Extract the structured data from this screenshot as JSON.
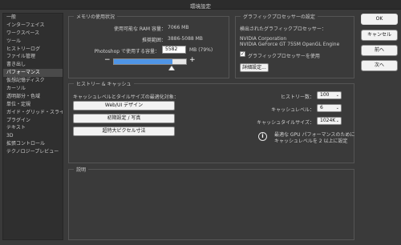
{
  "window": {
    "title": "環境設定"
  },
  "sidebar": {
    "items": [
      "一般",
      "インターフェイス",
      "ワークスペース",
      "ツール",
      "ヒストリーログ",
      "ファイル管理",
      "書き出し",
      "パフォーマンス",
      "仮想記憶ディスク",
      "カーソル",
      "透明部分・色域",
      "単位・定規",
      "ガイド・グリッド・スライス",
      "プラグイン",
      "テキスト",
      "3D",
      "拡張コントロール",
      "テクノロジープレビュー"
    ],
    "active_index": 7
  },
  "memory": {
    "section_title": "メモリの使用状況",
    "available_label": "使用可能な RAM 容量：",
    "available_value": "7066 MB",
    "ideal_label": "推奨範囲：",
    "ideal_value": "3886-5088 MB",
    "usage_label": "Photoshop で使用する容量：",
    "usage_value": "5582",
    "usage_unit": "MB (79%)",
    "usage_percent": 79,
    "minus": "−",
    "plus": "+"
  },
  "gpu": {
    "section_title": "グラフィックプロセッサーの設定",
    "detected_label": "検出されたグラフィックプロセッサー：",
    "vendor": "NVIDIA Corporation",
    "model": "NVIDIA GeForce GT 755M OpenGL Engine",
    "use_gpu_label": "グラフィックプロセッサーを使用",
    "use_gpu_checked": true,
    "advanced_button": "詳細設定..."
  },
  "history_cache": {
    "section_title": "ヒストリー & キャッシュ",
    "optimize_label": "キャッシュレベルとタイルサイズの最適化対象：",
    "buttons": [
      "Web/UI デザイン",
      "初期設定 / 写真",
      "超特大ピクセル寸法"
    ],
    "history_states_label": "ヒストリー数：",
    "history_states_value": "100",
    "cache_levels_label": "キャッシュレベル：",
    "cache_levels_value": "6",
    "cache_tile_label": "キャッシュタイルサイズ：",
    "cache_tile_value": "1024K",
    "gpu_note_line1": "最適な GPU パフォーマンスのために",
    "gpu_note_line2": "キャッシュレベルを 2 以上に設定"
  },
  "description": {
    "section_title": "説明"
  },
  "actions": {
    "ok": "OK",
    "cancel": "キャンセル",
    "prev": "前へ",
    "next": "次へ"
  },
  "colors": {
    "accent": "#4f95e6",
    "background": "#3a3a3a",
    "sidebar_active": "#4a4a4a"
  }
}
